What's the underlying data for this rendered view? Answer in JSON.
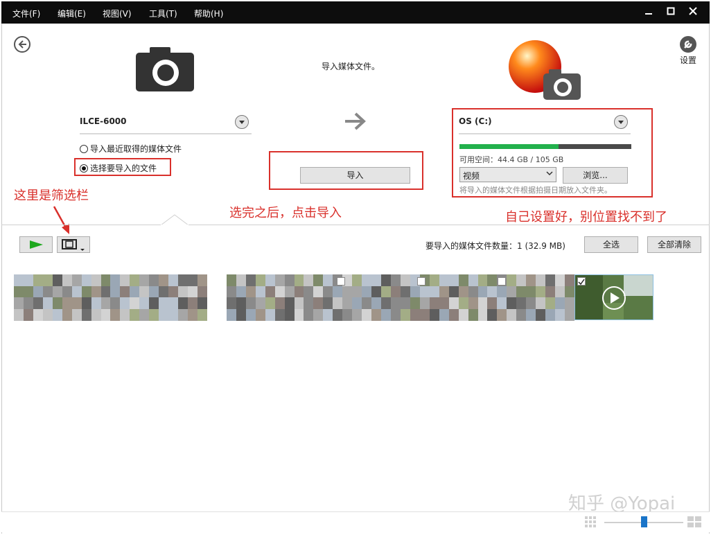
{
  "menu": [
    "文件(F)",
    "编辑(E)",
    "视图(V)",
    "工具(T)",
    "帮助(H)"
  ],
  "window_controls": [
    "minimize-icon",
    "maximize-icon",
    "close-icon"
  ],
  "header": {
    "headline": "导入媒体文件。",
    "settings_label": "设置"
  },
  "source": {
    "device": "ILCE-6000",
    "options": [
      "导入最近取得的媒体文件",
      "选择要导入的文件"
    ],
    "selected_option": 1
  },
  "import_button": "导入",
  "destination": {
    "drive": "OS (C:)",
    "space_label": "可用空间：",
    "space_value": "44.4 GB / 105 GB",
    "free_gb": 44.4,
    "total_gb": 105,
    "folder": "视频",
    "browse_label": "浏览...",
    "note": "将导入的媒体文件根据拍摄日期放入文件夹。"
  },
  "annotations": {
    "filter": "这里是筛选栏",
    "import": "选完之后，点击导入",
    "destination": "自己设置好，别位置找不到了"
  },
  "toolbar": {
    "count_label": "要导入的媒体文件数量：",
    "count_value": "1 (32.9 MB)",
    "select_all": "全选",
    "clear_all": "全部清除"
  },
  "watermark": "知乎 @Yopai",
  "colors": {
    "menubar": "#0d0d0d",
    "accent_red": "#d9302b",
    "storage_green": "#22b14c",
    "play_green": "#1ea81e"
  }
}
